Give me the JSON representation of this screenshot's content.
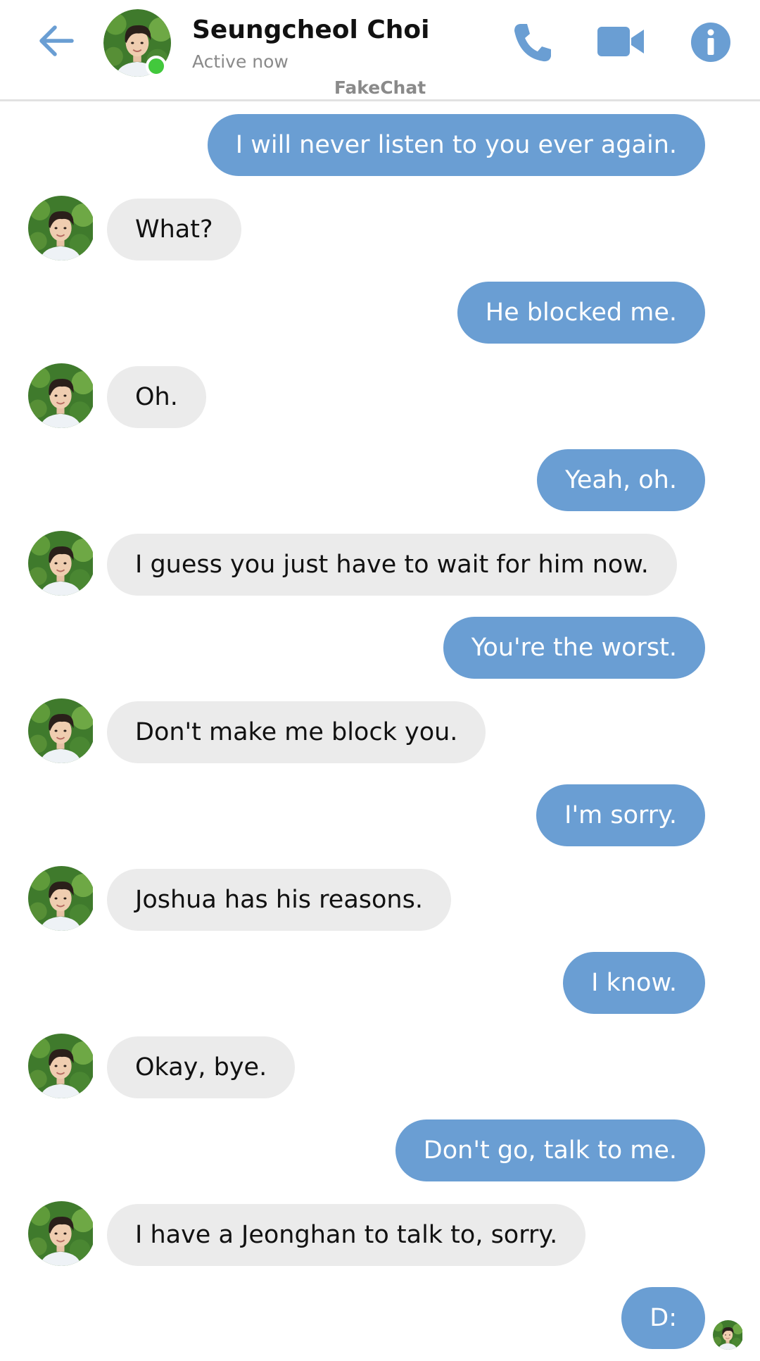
{
  "header": {
    "contact_name": "Seungcheol Choi",
    "status": "Active now",
    "app_watermark": "FakeChat",
    "online_color": "#42c83c",
    "icons": [
      "back-arrow-icon",
      "phone-icon",
      "video-camera-icon",
      "info-icon"
    ]
  },
  "colors": {
    "accent": "#6a9ed3",
    "incoming_bubble": "#ebebeb",
    "outgoing_text": "#ffffff",
    "incoming_text": "#111111"
  },
  "messages": [
    {
      "direction": "out",
      "text": "I will never listen to you ever again."
    },
    {
      "direction": "in",
      "text": "What?"
    },
    {
      "direction": "out",
      "text": "He blocked me."
    },
    {
      "direction": "in",
      "text": "Oh."
    },
    {
      "direction": "out",
      "text": "Yeah, oh."
    },
    {
      "direction": "in",
      "text": "I guess you just have to wait for him now."
    },
    {
      "direction": "out",
      "text": "You're the worst."
    },
    {
      "direction": "in",
      "text": "Don't make me block you."
    },
    {
      "direction": "out",
      "text": "I'm sorry."
    },
    {
      "direction": "in",
      "text": "Joshua has his reasons."
    },
    {
      "direction": "out",
      "text": "I know."
    },
    {
      "direction": "in",
      "text": "Okay, bye."
    },
    {
      "direction": "out",
      "text": "Don't go, talk to me."
    },
    {
      "direction": "in",
      "text": "I have a Jeonghan to talk to, sorry."
    },
    {
      "direction": "out",
      "text": "D:"
    }
  ]
}
